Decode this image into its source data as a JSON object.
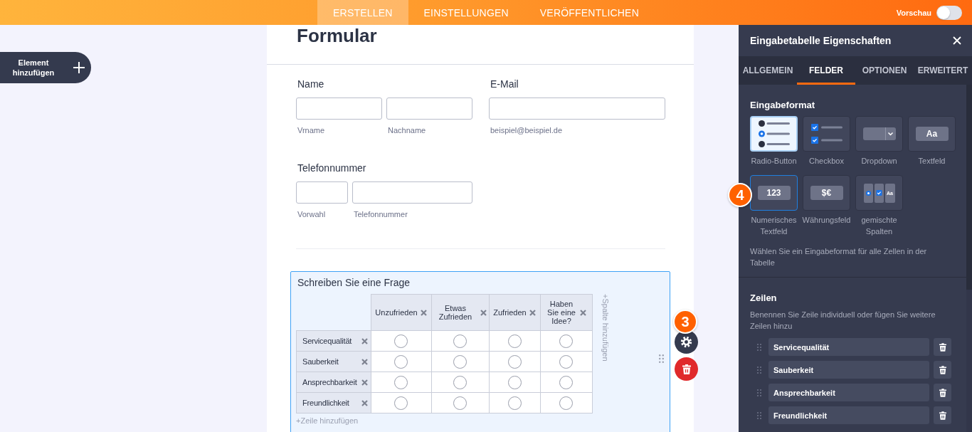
{
  "top_bar": {
    "tabs": [
      {
        "label": "ERSTELLEN",
        "selected": true
      },
      {
        "label": "EINSTELLUNGEN",
        "selected": false
      },
      {
        "label": "VERÖFFENTLICHEN",
        "selected": false
      }
    ],
    "preview": {
      "label": "Vorschau",
      "on": false
    }
  },
  "add_element": {
    "label": "Element hinzufügen"
  },
  "form": {
    "title": "Formular",
    "fields": [
      {
        "kind": "name",
        "label": "Name",
        "inputs": [
          {
            "sublabel": "Vrname"
          },
          {
            "sublabel": "Nachname"
          }
        ]
      },
      {
        "kind": "email",
        "label": "E-Mail",
        "inputs": [
          {
            "sublabel": "beispiel@beispiel.de"
          }
        ]
      },
      {
        "kind": "phone",
        "label": "Telefonnummer",
        "inputs": [
          {
            "sublabel": "Vorwahl"
          },
          {
            "sublabel": "Telefonnummer"
          }
        ]
      }
    ],
    "question": {
      "selected": true,
      "title": "Schreiben Sie eine Frage",
      "step_badge": "3",
      "columns": [
        "Unzufrieden",
        "Etwas Zufrieden",
        "Zufrieden",
        "Haben Sie eine Idee?"
      ],
      "rows": [
        {
          "label": "Servicequalität",
          "cells": [
            {
              "selected": false
            },
            {
              "selected": false
            },
            {
              "selected": false
            },
            {
              "selected": false
            }
          ]
        },
        {
          "label": "Sauberkeit",
          "cells": [
            {
              "selected": false
            },
            {
              "selected": false
            },
            {
              "selected": false
            },
            {
              "selected": false
            }
          ]
        },
        {
          "label": "Ansprechbarkeit",
          "cells": [
            {
              "selected": false
            },
            {
              "selected": false
            },
            {
              "selected": false
            },
            {
              "selected": false
            }
          ]
        },
        {
          "label": "Freundlichkeit",
          "cells": [
            {
              "selected": false
            },
            {
              "selected": false
            },
            {
              "selected": false
            },
            {
              "selected": false
            }
          ]
        }
      ],
      "add_column": "+Spalte hinzufügen",
      "add_row": "+Zeile hinzufügen"
    }
  },
  "properties_panel": {
    "title": "Eingabetabelle Eigenschaften",
    "tabs": [
      {
        "label": "ALLGEMEIN",
        "selected": false
      },
      {
        "label": "FELDER",
        "selected": true
      },
      {
        "label": "OPTIONEN",
        "selected": false
      },
      {
        "label": "ERWEITERT",
        "selected": false
      }
    ],
    "input_format": {
      "heading": "Eingabeformat",
      "options": [
        {
          "kind": "radio",
          "label": "Radio-Button",
          "selected": true,
          "highlighted": false
        },
        {
          "kind": "checkbox",
          "label": "Checkbox",
          "selected": false,
          "highlighted": false
        },
        {
          "kind": "dropdown",
          "label": "Dropdown",
          "selected": false,
          "highlighted": false
        },
        {
          "kind": "text",
          "label": "Textfeld",
          "preview_text": "Aa",
          "selected": false,
          "highlighted": false
        },
        {
          "kind": "number",
          "label": "Numerisches Textfeld",
          "preview_text": "123",
          "step_badge": "4",
          "selected": false,
          "highlighted": true
        },
        {
          "kind": "currency",
          "label": "Währungsfeld",
          "preview_text": "$€",
          "selected": false,
          "highlighted": false
        },
        {
          "kind": "mixed",
          "label": "gemischte Spalten",
          "preview_text": "Aa",
          "selected": false,
          "highlighted": false
        }
      ],
      "hint": "Wählen Sie ein Eingabeformat für alle Zellen in der Tabelle"
    },
    "rows_section": {
      "heading": "Zeilen",
      "hint": "Benennen Sie Zeile individuell oder fügen Sie weitere Zeilen hinzu",
      "rows": [
        {
          "value": "Servicequalität"
        },
        {
          "value": "Sauberkeit"
        },
        {
          "value": "Ansprechbarkeit"
        },
        {
          "value": "Freundlichkeit"
        }
      ]
    }
  }
}
